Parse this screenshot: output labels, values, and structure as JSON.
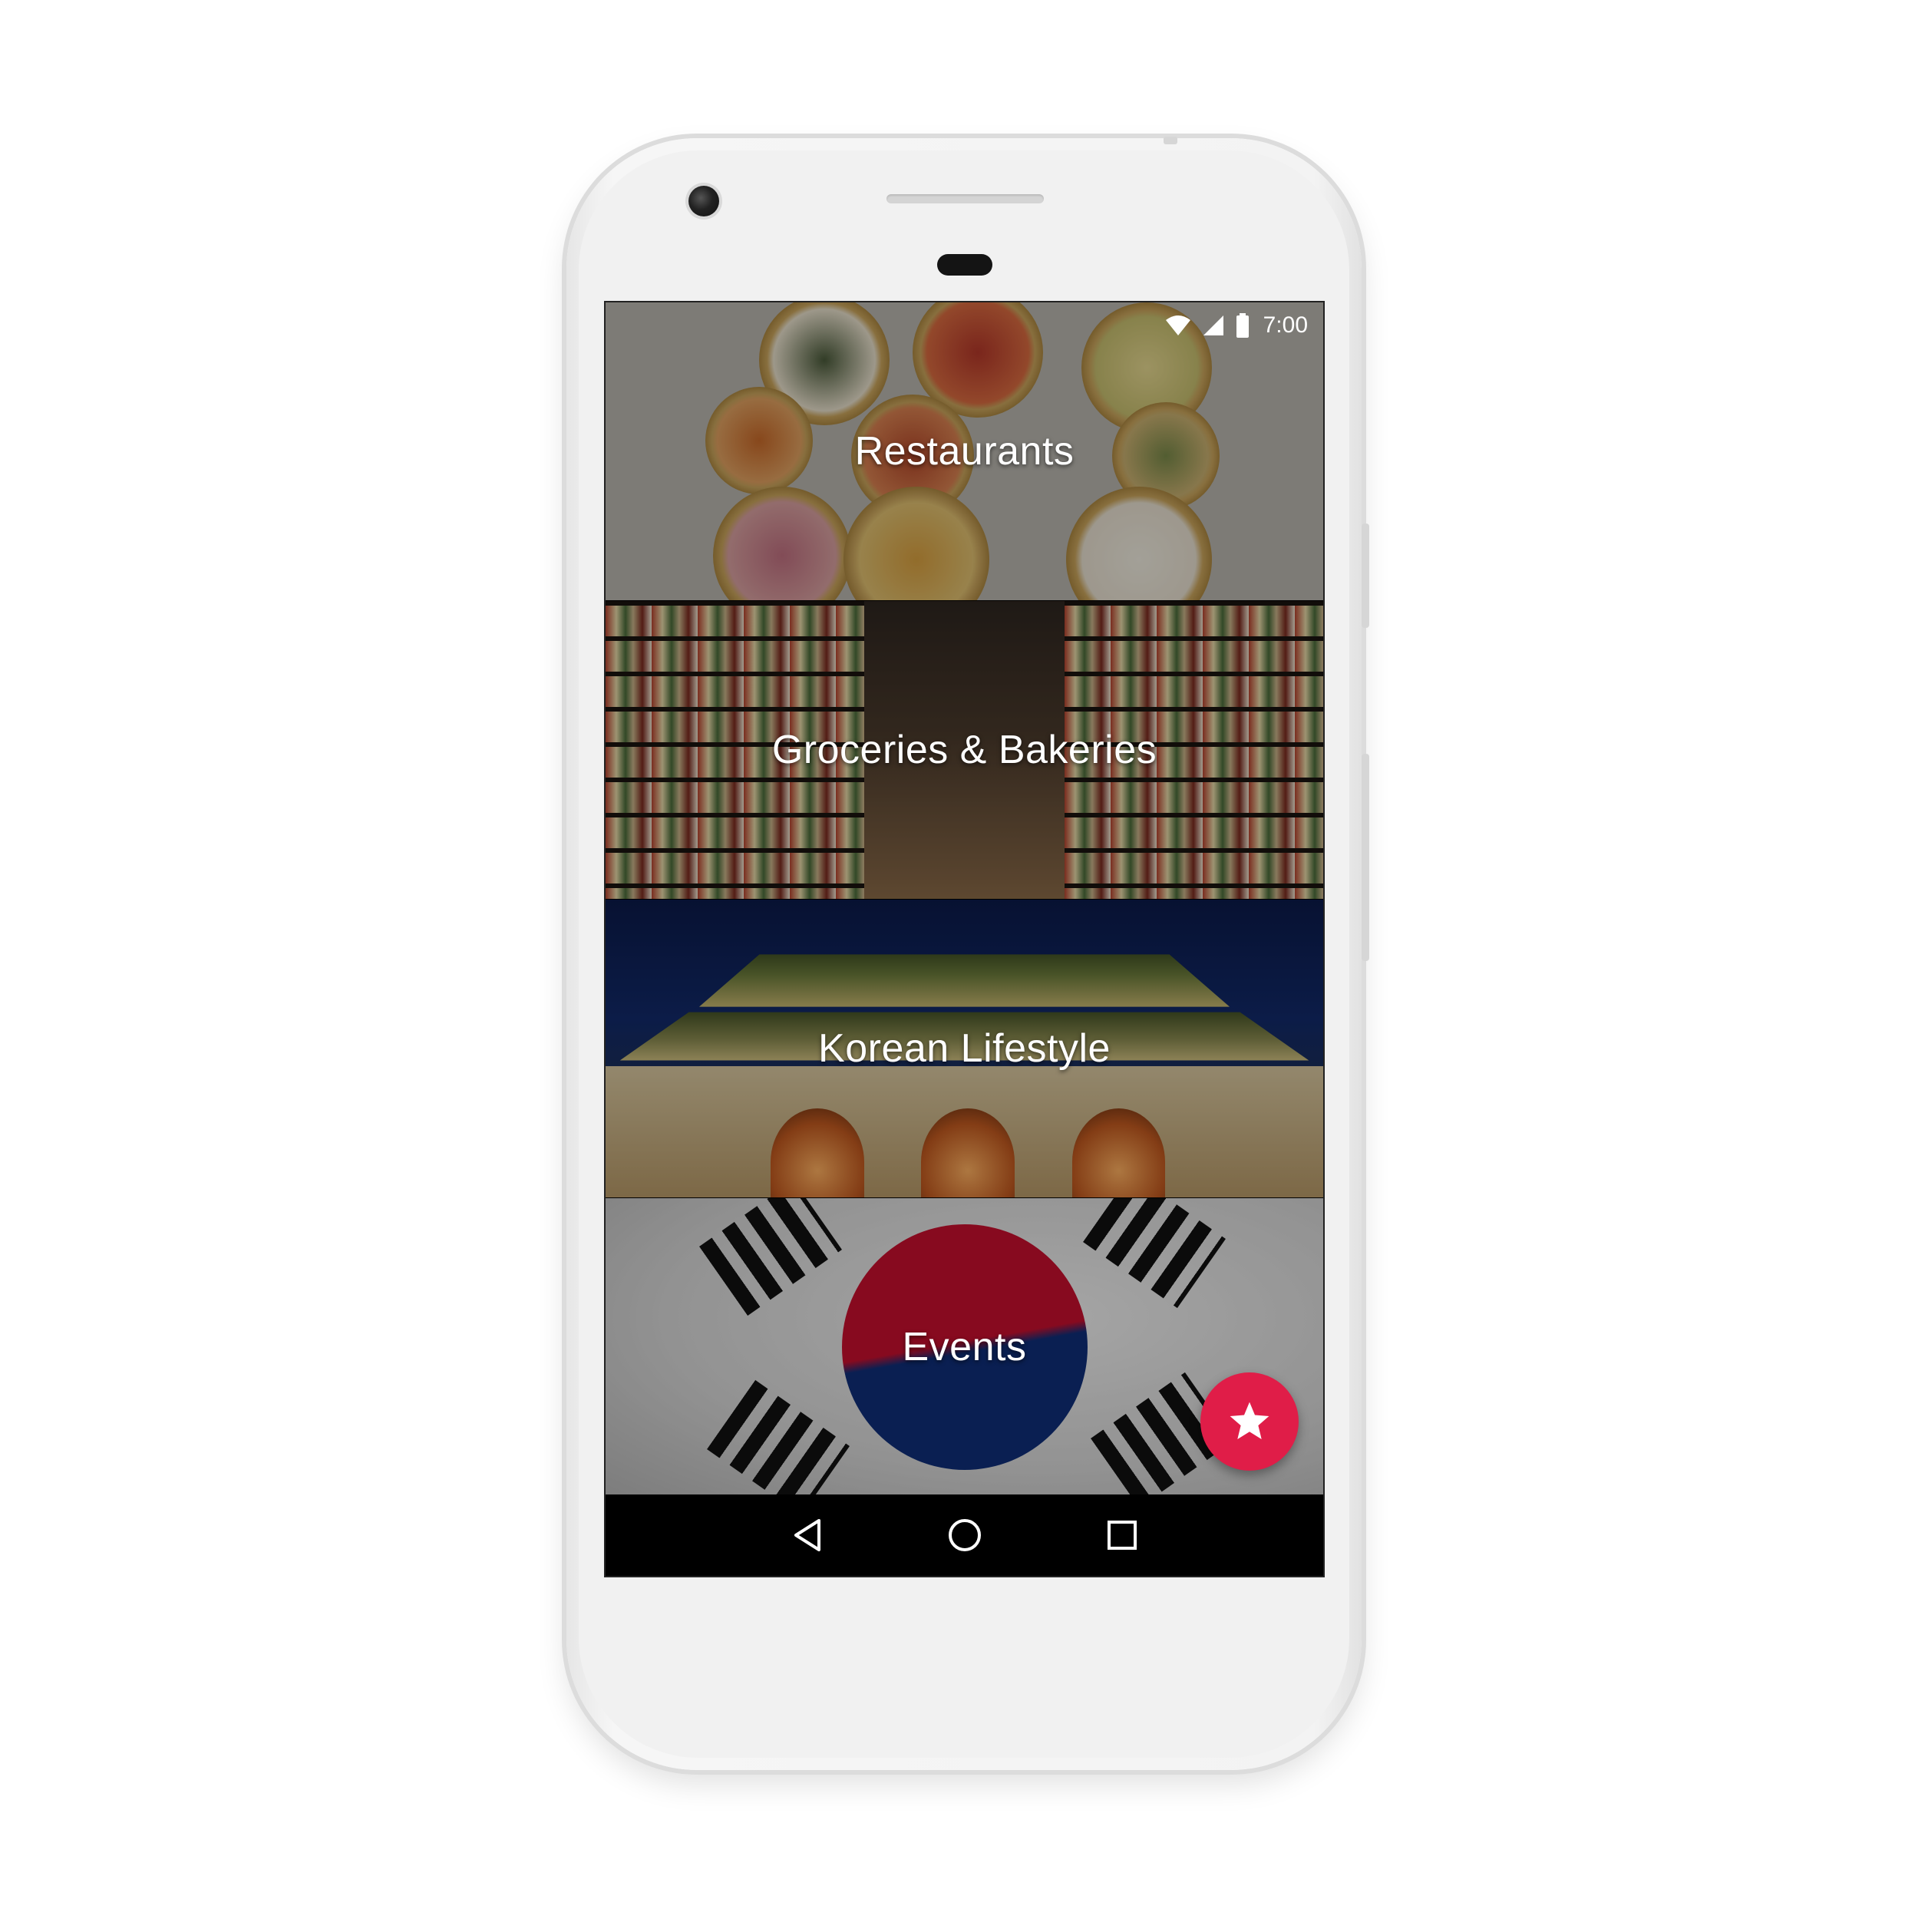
{
  "status_bar": {
    "time": "7:00",
    "icons": [
      "wifi-icon",
      "cellular-signal-icon",
      "battery-icon"
    ]
  },
  "tiles": [
    {
      "label": "Restaurants",
      "image": "korean-food-bowls"
    },
    {
      "label": "Groceries & Bakeries",
      "image": "grocery-store-aisle"
    },
    {
      "label": "Korean Lifestyle",
      "image": "gwanghwamun-gate"
    },
    {
      "label": "Events",
      "image": "korean-flag"
    }
  ],
  "fab": {
    "icon": "star-icon",
    "color": "#e01d48"
  },
  "nav_bar": {
    "buttons": [
      "back-icon",
      "home-icon",
      "recents-icon"
    ]
  },
  "colors": {
    "accent": "#e01d48",
    "nav_background": "#000000"
  }
}
